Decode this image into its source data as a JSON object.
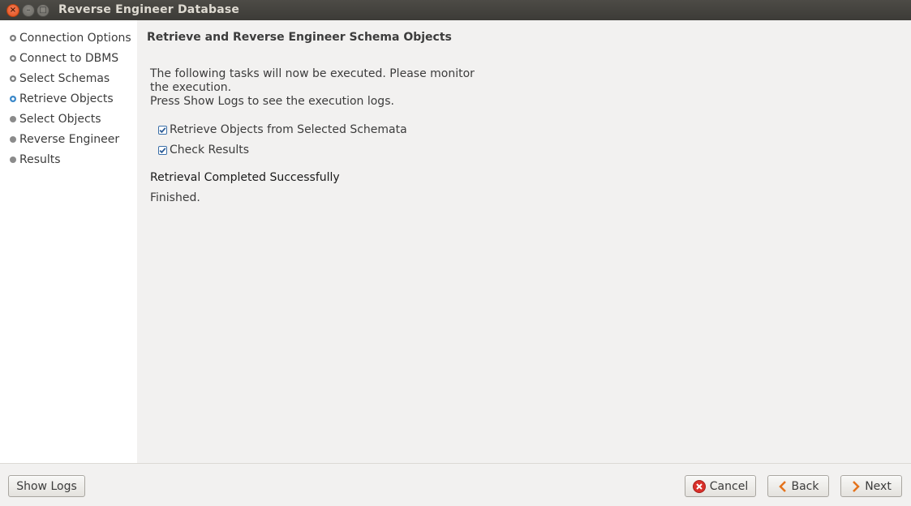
{
  "window": {
    "title": "Reverse Engineer Database",
    "controls": {
      "close": "×",
      "minimize": "–",
      "maximize": "□"
    }
  },
  "sidebar": {
    "steps": [
      {
        "label": "Connection Options",
        "state": "done"
      },
      {
        "label": "Connect to DBMS",
        "state": "done"
      },
      {
        "label": "Select Schemas",
        "state": "done"
      },
      {
        "label": "Retrieve Objects",
        "state": "current"
      },
      {
        "label": "Select Objects",
        "state": "pending"
      },
      {
        "label": "Reverse Engineer",
        "state": "pending"
      },
      {
        "label": "Results",
        "state": "pending"
      }
    ]
  },
  "main": {
    "heading": "Retrieve and Reverse Engineer Schema Objects",
    "description_line1": "The following tasks will now be executed. Please monitor",
    "description_line2": "the execution.",
    "description_line3": "Press Show Logs to see the execution logs.",
    "tasks": [
      {
        "label": "Retrieve Objects from Selected Schemata",
        "checked": true
      },
      {
        "label": "Check Results",
        "checked": true
      }
    ],
    "status_title": "Retrieval Completed Successfully",
    "status_text": "Finished."
  },
  "buttons": {
    "show_logs": "Show Logs",
    "cancel": "Cancel",
    "back": "Back",
    "next": "Next"
  },
  "colors": {
    "current_step": "#3b88c9",
    "cancel_icon": "#d9302a",
    "nav_arrow": "#e4731d"
  }
}
